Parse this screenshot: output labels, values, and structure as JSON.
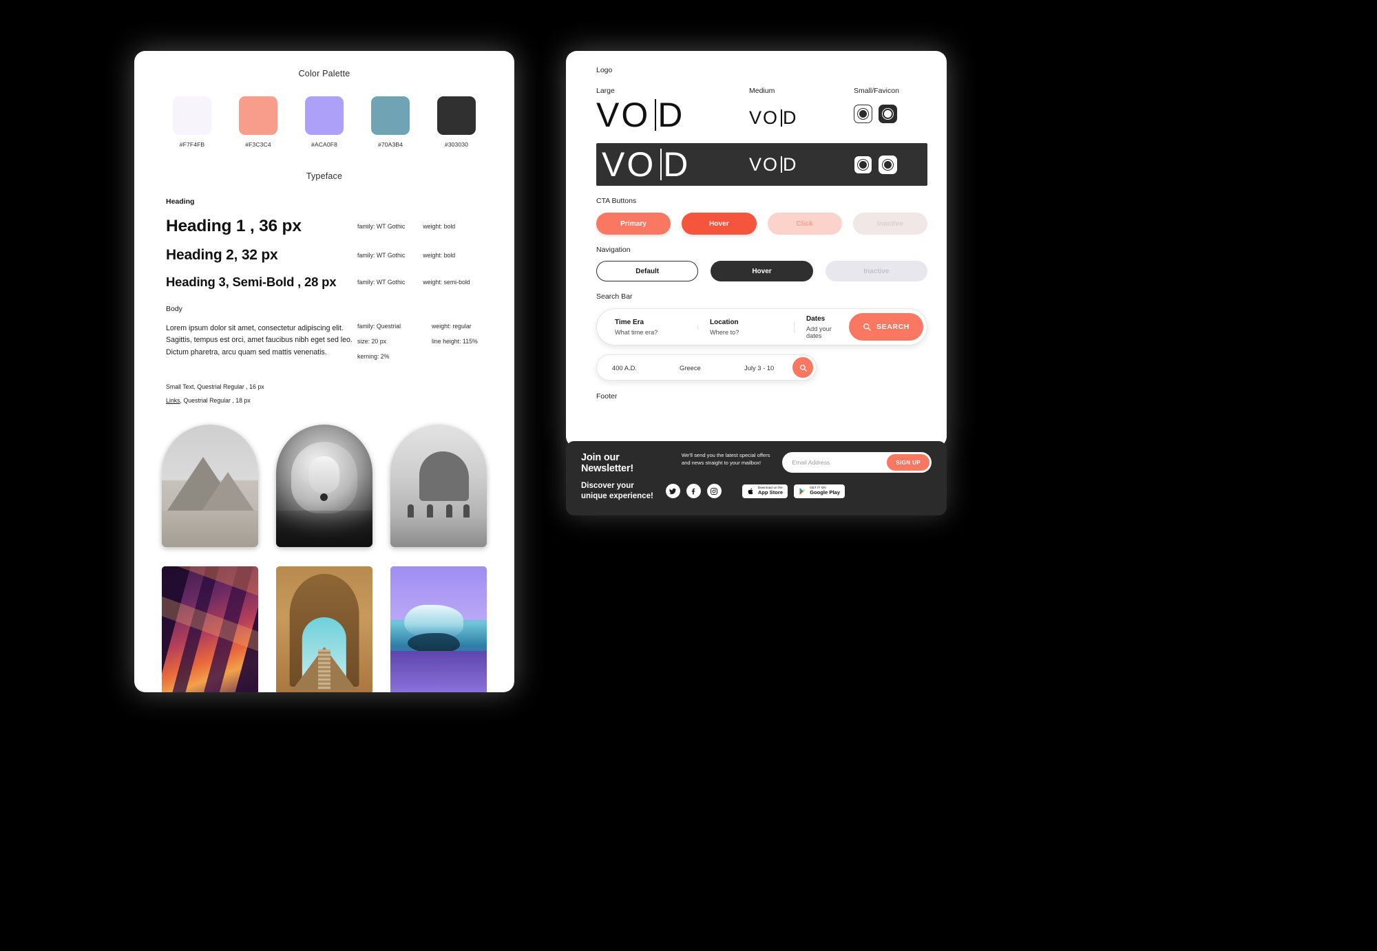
{
  "left_panel": {
    "palette_title": "Color Palette",
    "swatches": [
      {
        "hex": "#F7F4FB",
        "label": "#F7F4FB"
      },
      {
        "hex": "#F3C3C4",
        "label": "#F3C3C4"
      },
      {
        "hex": "#ACA0F8",
        "label": "#ACA0F8"
      },
      {
        "hex": "#70A3B4",
        "label": "#70A3B4"
      },
      {
        "hex": "#303030",
        "label": "#303030"
      }
    ],
    "typeface_title": "Typeface",
    "heading_label": "Heading",
    "headings": [
      {
        "sample": "Heading 1 , 36 px",
        "family": "family: WT Gothic",
        "weight": "weight: bold"
      },
      {
        "sample": "Heading 2, 32 px",
        "family": "family: WT Gothic",
        "weight": "weight: bold"
      },
      {
        "sample": "Heading 3, Semi-Bold , 28 px",
        "family": "family: WT Gothic",
        "weight": "weight: semi-bold"
      }
    ],
    "body_label": "Body",
    "body_copy": "Lorem ipsum dolor sit amet, consectetur adipiscing elit. Sagittis, tempus est orci, amet faucibus nibh eget sed leo. Dictum pharetra, arcu quam sed mattis venenatis.",
    "body_specs": [
      {
        "left": "family: Questrial",
        "right": "weight: regular"
      },
      {
        "left": "size: 20 px",
        "right": "line height: 115%"
      },
      {
        "left": "kerning: 2%",
        "right": ""
      }
    ],
    "small_text": "Small Text, Questrial Regular , 16 px",
    "links_text_underlined": "Links",
    "links_text_rest": ", Questrial Regular , 18 px",
    "images": [
      {
        "name": "pyramids-photo",
        "caption": ""
      },
      {
        "name": "singer-photo",
        "caption": ""
      },
      {
        "name": "sea-stacks-photo",
        "caption": ""
      },
      {
        "name": "slot-canyon-photo",
        "caption": ""
      },
      {
        "name": "mayan-temple-photo",
        "caption": ""
      },
      {
        "name": "iceberg-photo",
        "caption": ""
      }
    ]
  },
  "right_panel": {
    "logo_label": "Logo",
    "logo_sizes": {
      "large": "Large",
      "medium": "Medium",
      "small": "Small/Favicon"
    },
    "brand": {
      "v": "V",
      "o": "O",
      "i": "I",
      "d": "D",
      "wordmark": "VOID"
    },
    "cta_label": "CTA Buttons",
    "cta_buttons": [
      {
        "label": "Primary",
        "state": "primary",
        "color": "#FA7861"
      },
      {
        "label": "Hover",
        "state": "hover",
        "color": "#F4553C"
      },
      {
        "label": "Click",
        "state": "click",
        "color": "#FBD3CA"
      },
      {
        "label": "Inactive",
        "state": "inactive",
        "color": "#F0E7E6"
      }
    ],
    "nav_label": "Navigation",
    "nav_buttons": [
      {
        "label": "Default",
        "state": "default"
      },
      {
        "label": "Hover",
        "state": "hover"
      },
      {
        "label": "Inactive",
        "state": "inactive"
      }
    ],
    "search_label": "Search Bar",
    "search_large": {
      "fields": [
        {
          "title": "Time Era",
          "placeholder": "What time era?"
        },
        {
          "title": "Location",
          "placeholder": "Where to?"
        },
        {
          "title": "Dates",
          "placeholder": "Add your dates"
        }
      ],
      "button_label": "SEARCH",
      "button_icon": "search-icon"
    },
    "search_small": {
      "values": [
        "400 A.D.",
        "Greece",
        "July 3 - 10"
      ],
      "button_icon": "search-icon"
    },
    "footer_label": "Footer"
  },
  "footer": {
    "headline": "Join our Newsletter!",
    "description": "We'll send you the latest special offers and news straight to your mailbox!",
    "email_placeholder": "Email Address",
    "signup_label": "SIGN UP",
    "tagline_line1": "Discover your",
    "tagline_line2": "unique experience!",
    "socials": [
      "twitter-icon",
      "facebook-icon",
      "instagram-icon"
    ],
    "stores": [
      {
        "small": "Download on the",
        "big": "App Store",
        "icon": "apple-icon"
      },
      {
        "small": "GET IT ON",
        "big": "Google Play",
        "icon": "google-play-icon"
      }
    ]
  }
}
